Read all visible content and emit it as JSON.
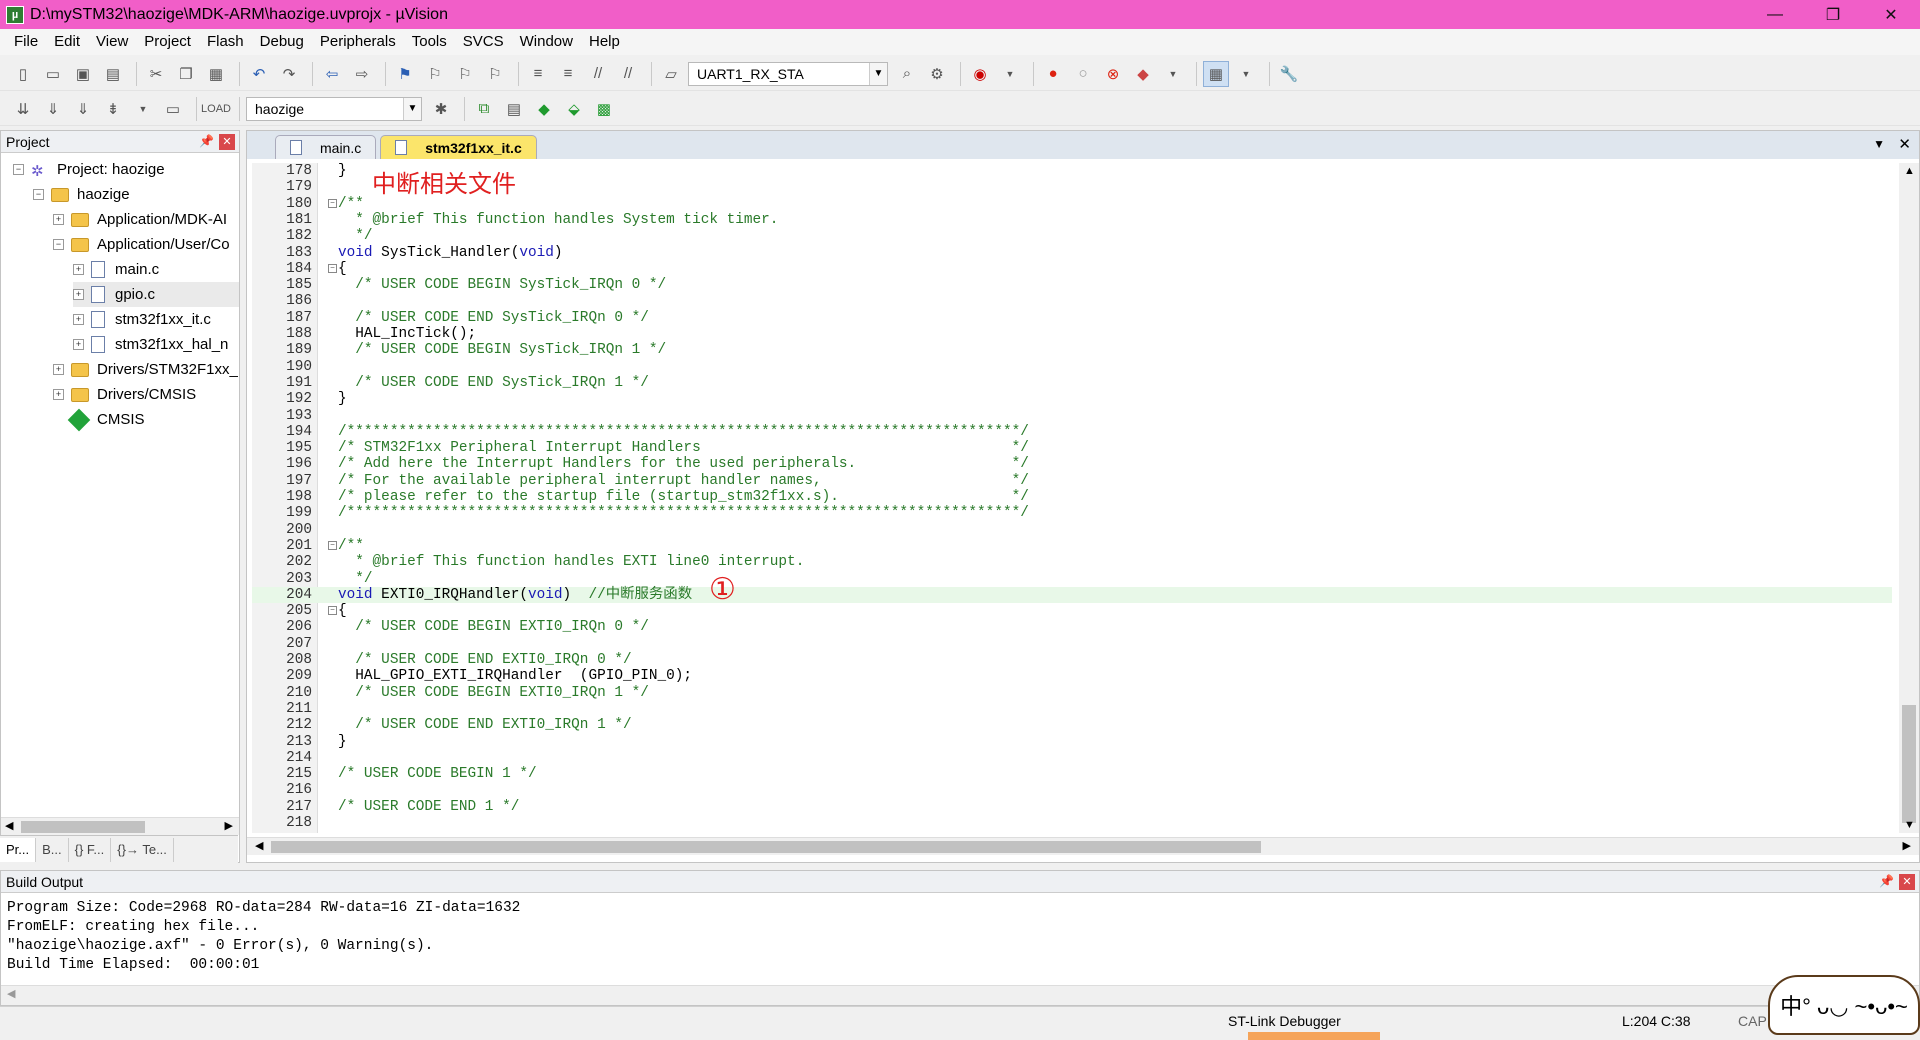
{
  "window": {
    "title": "D:\\mySTM32\\haozige\\MDK-ARM\\haozige.uvprojx - µVision",
    "minimize": "—",
    "restore": "❐",
    "close": "✕"
  },
  "menu": [
    "File",
    "Edit",
    "View",
    "Project",
    "Flash",
    "Debug",
    "Peripherals",
    "Tools",
    "SVCS",
    "Window",
    "Help"
  ],
  "toolbar1": {
    "combo_value": "UART1_RX_STA"
  },
  "toolbar2": {
    "combo_value": "haozige"
  },
  "project_panel": {
    "title": "Project",
    "tree": [
      {
        "label": "Project: haozige",
        "level": 0,
        "type": "project",
        "expander": "−"
      },
      {
        "label": "haozige",
        "level": 1,
        "type": "target",
        "expander": "−"
      },
      {
        "label": "Application/MDK-AI",
        "level": 2,
        "type": "folder",
        "expander": "+"
      },
      {
        "label": "Application/User/Co",
        "level": 2,
        "type": "folder",
        "expander": "−"
      },
      {
        "label": "main.c",
        "level": 3,
        "type": "file",
        "expander": "+"
      },
      {
        "label": "gpio.c",
        "level": 3,
        "type": "file",
        "expander": "+"
      },
      {
        "label": "stm32f1xx_it.c",
        "level": 3,
        "type": "file",
        "expander": "+"
      },
      {
        "label": "stm32f1xx_hal_n",
        "level": 3,
        "type": "file",
        "expander": "+"
      },
      {
        "label": "Drivers/STM32F1xx_",
        "level": 2,
        "type": "folder",
        "expander": "+"
      },
      {
        "label": "Drivers/CMSIS",
        "level": 2,
        "type": "folder",
        "expander": "+"
      },
      {
        "label": "CMSIS",
        "level": 2,
        "type": "gem",
        "expander": ""
      }
    ],
    "bottom_tabs": [
      "Pr...",
      "B...",
      "{} F...",
      "{}→ Te..."
    ]
  },
  "editor": {
    "tabs": [
      {
        "label": "main.c",
        "active": false
      },
      {
        "label": "stm32f1xx_it.c",
        "active": true
      }
    ],
    "annotation_title": "中断相关文件",
    "annotation_marker": "①",
    "lines": [
      {
        "n": "178",
        "code": "}",
        "fold": ""
      },
      {
        "n": "179",
        "code": "",
        "fold": ""
      },
      {
        "n": "180",
        "code": "/**",
        "fold": "−"
      },
      {
        "n": "181",
        "code": "  * @brief This function handles System tick timer.",
        "fold": ""
      },
      {
        "n": "182",
        "code": "  */",
        "fold": ""
      },
      {
        "n": "183",
        "code": "void SysTick_Handler(void)",
        "fold": ""
      },
      {
        "n": "184",
        "code": "{",
        "fold": "−"
      },
      {
        "n": "185",
        "code": "  /* USER CODE BEGIN SysTick_IRQn 0 */",
        "fold": ""
      },
      {
        "n": "186",
        "code": "",
        "fold": ""
      },
      {
        "n": "187",
        "code": "  /* USER CODE END SysTick_IRQn 0 */",
        "fold": ""
      },
      {
        "n": "188",
        "code": "  HAL_IncTick();",
        "fold": ""
      },
      {
        "n": "189",
        "code": "  /* USER CODE BEGIN SysTick_IRQn 1 */",
        "fold": ""
      },
      {
        "n": "190",
        "code": "",
        "fold": ""
      },
      {
        "n": "191",
        "code": "  /* USER CODE END SysTick_IRQn 1 */",
        "fold": ""
      },
      {
        "n": "192",
        "code": "}",
        "fold": ""
      },
      {
        "n": "193",
        "code": "",
        "fold": ""
      },
      {
        "n": "194",
        "code": "/******************************************************************************/",
        "fold": ""
      },
      {
        "n": "195",
        "code": "/* STM32F1xx Peripheral Interrupt Handlers                                    */",
        "fold": ""
      },
      {
        "n": "196",
        "code": "/* Add here the Interrupt Handlers for the used peripherals.                  */",
        "fold": ""
      },
      {
        "n": "197",
        "code": "/* For the available peripheral interrupt handler names,                      */",
        "fold": ""
      },
      {
        "n": "198",
        "code": "/* please refer to the startup file (startup_stm32f1xx.s).                    */",
        "fold": ""
      },
      {
        "n": "199",
        "code": "/******************************************************************************/",
        "fold": ""
      },
      {
        "n": "200",
        "code": "",
        "fold": ""
      },
      {
        "n": "201",
        "code": "/**",
        "fold": "−"
      },
      {
        "n": "202",
        "code": "  * @brief This function handles EXTI line0 interrupt.",
        "fold": ""
      },
      {
        "n": "203",
        "code": "  */",
        "fold": ""
      },
      {
        "n": "204",
        "code": "void EXTI0_IRQHandler(void)  //中断服务函数",
        "fold": ""
      },
      {
        "n": "205",
        "code": "{",
        "fold": "−"
      },
      {
        "n": "206",
        "code": "  /* USER CODE BEGIN EXTI0_IRQn 0 */",
        "fold": ""
      },
      {
        "n": "207",
        "code": "",
        "fold": ""
      },
      {
        "n": "208",
        "code": "  /* USER CODE END EXTI0_IRQn 0 */",
        "fold": ""
      },
      {
        "n": "209",
        "code": "  HAL_GPIO_EXTI_IRQHandler  (GPIO_PIN_0);",
        "fold": ""
      },
      {
        "n": "210",
        "code": "  /* USER CODE BEGIN EXTI0_IRQn 1 */",
        "fold": ""
      },
      {
        "n": "211",
        "code": "",
        "fold": ""
      },
      {
        "n": "212",
        "code": "  /* USER CODE END EXTI0_IRQn 1 */",
        "fold": ""
      },
      {
        "n": "213",
        "code": "}",
        "fold": ""
      },
      {
        "n": "214",
        "code": "",
        "fold": ""
      },
      {
        "n": "215",
        "code": "/* USER CODE BEGIN 1 */",
        "fold": ""
      },
      {
        "n": "216",
        "code": "",
        "fold": ""
      },
      {
        "n": "217",
        "code": "/* USER CODE END 1 */",
        "fold": ""
      },
      {
        "n": "218",
        "code": "",
        "fold": ""
      }
    ]
  },
  "build_output": {
    "title": "Build Output",
    "lines": [
      "Program Size: Code=2968 RO-data=284 RW-data=16 ZI-data=1632",
      "FromELF: creating hex file...",
      "\"haozige\\haozige.axf\" - 0 Error(s), 0 Warning(s).",
      "Build Time Elapsed:  00:00:01"
    ]
  },
  "status": {
    "debugger": "ST-Link Debugger",
    "position": "L:204 C:38",
    "caps": "CAP"
  },
  "mascot": "中° ᴗ◡ ~•ᴗ•~"
}
